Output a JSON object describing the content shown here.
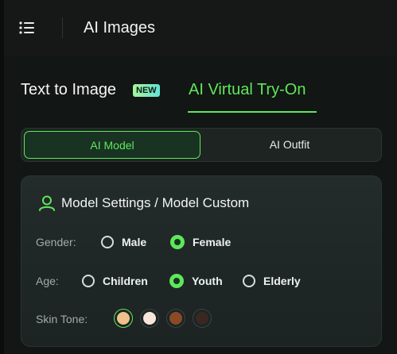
{
  "header": {
    "title": "AI Images"
  },
  "tabs": [
    {
      "label": "Text to Image",
      "badge": "NEW",
      "active": false
    },
    {
      "label": "AI Virtual Try-On",
      "active": true
    }
  ],
  "segment": {
    "options": [
      {
        "label": "AI Model",
        "selected": true
      },
      {
        "label": "AI Outfit",
        "selected": false
      }
    ]
  },
  "settings": {
    "title": "Model Settings / Model Custom",
    "gender": {
      "label": "Gender:",
      "options": [
        {
          "label": "Male",
          "selected": false
        },
        {
          "label": "Female",
          "selected": true
        }
      ]
    },
    "age": {
      "label": "Age:",
      "options": [
        {
          "label": "Children",
          "selected": false
        },
        {
          "label": "Youth",
          "selected": true
        },
        {
          "label": "Elderly",
          "selected": false
        }
      ]
    },
    "skin_tone": {
      "label": "Skin Tone:",
      "swatches": [
        {
          "color": "#f0c18a",
          "selected": true
        },
        {
          "color": "#f9e6da",
          "selected": false
        },
        {
          "color": "#8a4a26",
          "selected": false
        },
        {
          "color": "#3b2721",
          "selected": false
        }
      ]
    }
  },
  "colors": {
    "accent": "#5fe75b",
    "background": "#121614",
    "card": "#212a29"
  },
  "icons": {
    "menu": "menu-list-icon",
    "model": "user-outline-icon"
  }
}
